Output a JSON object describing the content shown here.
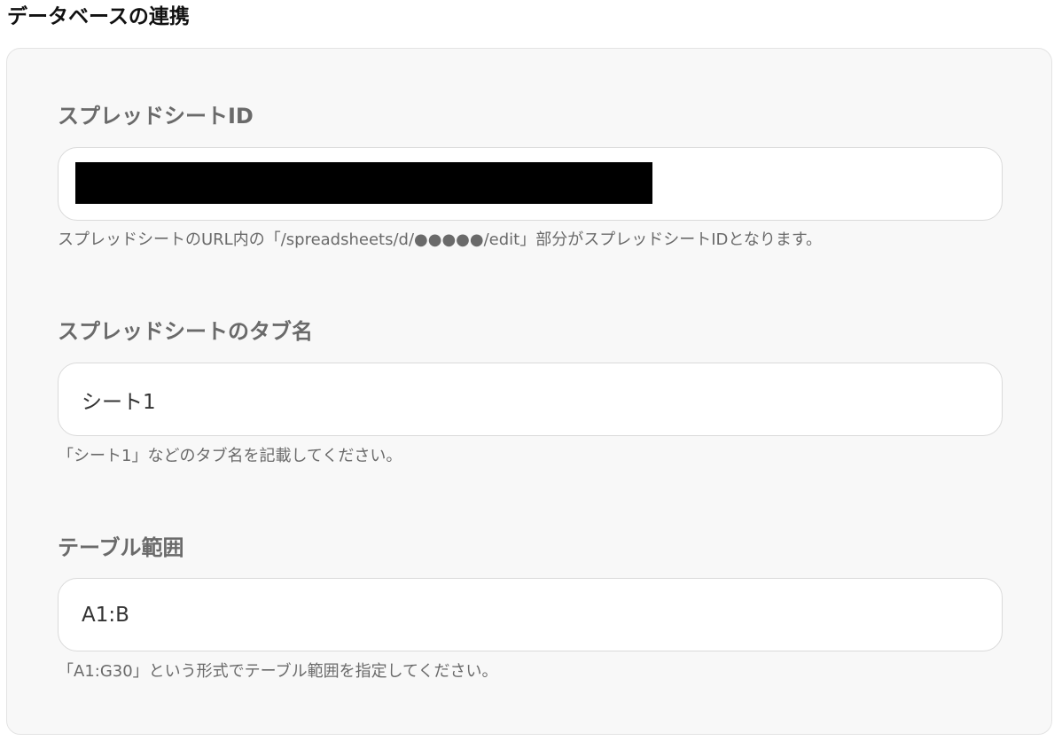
{
  "section": {
    "title": "データベースの連携"
  },
  "fields": {
    "spreadsheet_id": {
      "label": "スプレッドシートID",
      "value": "",
      "help": "スプレッドシートのURL内の「/spreadsheets/d/●●●●●/edit」部分がスプレッドシートIDとなります。"
    },
    "tab_name": {
      "label": "スプレッドシートのタブ名",
      "value": "シート1",
      "help": "「シート1」などのタブ名を記載してください。"
    },
    "table_range": {
      "label": "テーブル範囲",
      "value": "A1:B",
      "help": "「A1:G30」という形式でテーブル範囲を指定してください。"
    }
  },
  "colors": {
    "panel_background": "#f8f8f8",
    "label_text": "#6a6a6a",
    "title_text": "#111111",
    "redaction": "#000000"
  }
}
